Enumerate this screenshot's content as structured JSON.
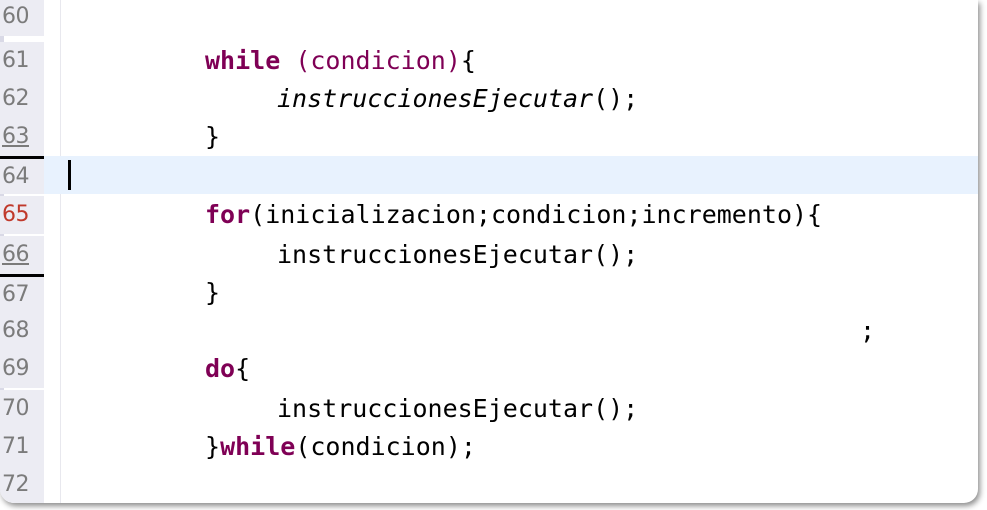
{
  "editor": {
    "lines": [
      {
        "number": "60",
        "code": ""
      },
      {
        "number": "61",
        "keyword": "while",
        "rest_plain": " ",
        "condition": "(condicion)",
        "tail": "{"
      },
      {
        "number": "62",
        "call": "instruccionesEjecutar",
        "tail": "();"
      },
      {
        "number": "63",
        "code": "}"
      },
      {
        "number": "64",
        "code": ""
      },
      {
        "number": "65",
        "keyword": "for",
        "rest": "(inicializacion;condicion;incremento){"
      },
      {
        "number": "66",
        "code": "instruccionesEjecutar();"
      },
      {
        "number": "67",
        "code": "}"
      },
      {
        "number": "68",
        "code": ";"
      },
      {
        "number": "69",
        "keyword": "do",
        "rest": "{"
      },
      {
        "number": "70",
        "code": "instruccionesEjecutar();"
      },
      {
        "number": "71",
        "pre": "}",
        "keyword": "while",
        "rest": "(condicion);"
      },
      {
        "number": "72",
        "code": ""
      }
    ],
    "colors": {
      "keyword": "#7f0055",
      "current_line": "#e8f2fe",
      "gutter": "#ececf3",
      "line_number": "#7b7b7b"
    }
  }
}
